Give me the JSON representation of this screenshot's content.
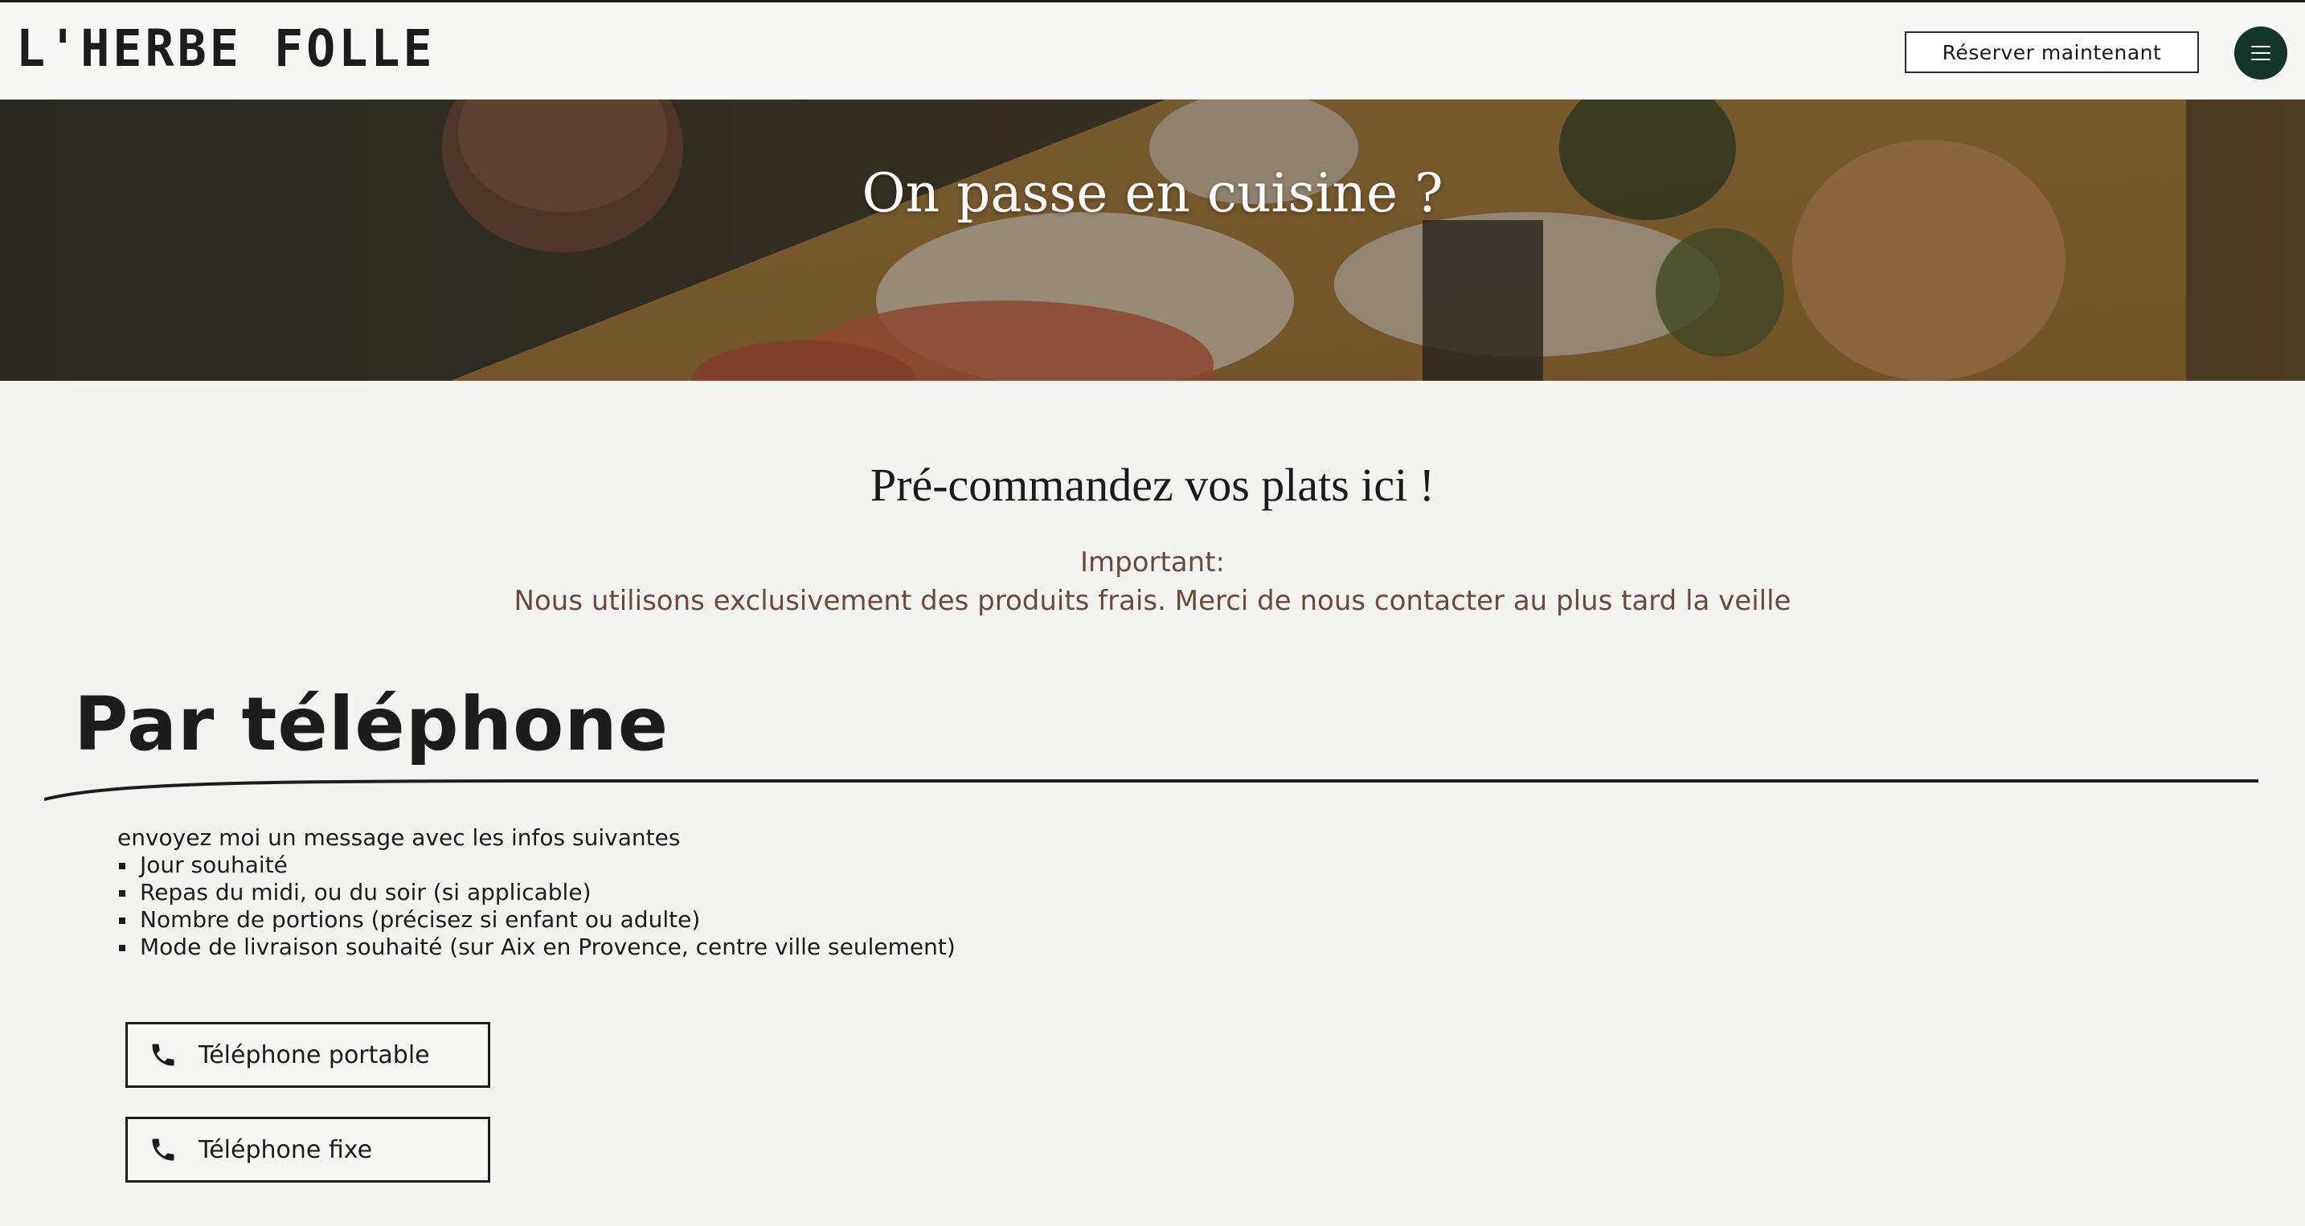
{
  "header": {
    "logo": "L'HERBE FOLLE",
    "reserve_label": "Réserver maintenant",
    "menu_icon": "hamburger-icon"
  },
  "hero": {
    "title": "On passe en cuisine ?"
  },
  "main": {
    "title": "Pré-commandez vos plats ici !",
    "important_label": "Important:",
    "important_text": "Nous utilisons exclusivement des produits frais. Merci de nous contacter au plus tard la veille"
  },
  "phone_section": {
    "heading": "Par téléphone",
    "intro": "envoyez moi un message avec les infos suivantes",
    "items": [
      "Jour souhaité",
      "Repas du midi, ou du soir (si applicable)",
      "Nombre de portions (précisez si enfant ou adulte)",
      "Mode de livraison souhaité (sur Aix en Provence, centre ville seulement)"
    ],
    "buttons": [
      {
        "label": "Téléphone portable",
        "icon": "phone-icon"
      },
      {
        "label": "Téléphone fixe",
        "icon": "phone-icon"
      }
    ]
  },
  "colors": {
    "menu_button": "#12362a",
    "important_text": "#6a4a3c",
    "page_background": "#f3f3f2"
  }
}
